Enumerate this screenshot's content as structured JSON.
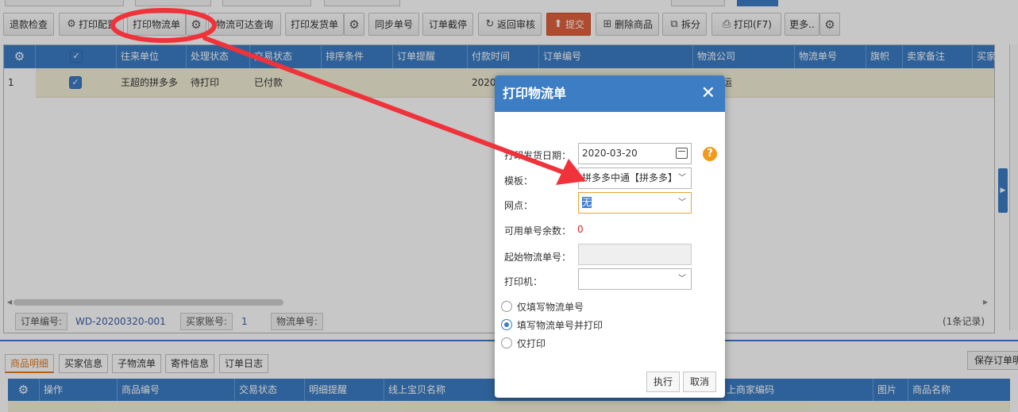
{
  "toolbar": {
    "refund_check": "退款检查",
    "print_config": "打印配置",
    "print_waybill": "打印物流单",
    "logistics_query": "物流可达查询",
    "print_delivery": "打印发货单",
    "sync_number": "同步单号",
    "order_intercept": "订单截停",
    "return_review": "返回审核",
    "submit": "提交",
    "delete_item": "删除商品",
    "split": "拆分",
    "print": "打印(F7)",
    "more": "更多.."
  },
  "grid": {
    "columns": [
      "往来单位",
      "处理状态",
      "交易状态",
      "排序条件",
      "订单提醒",
      "付款时间",
      "订单编号",
      "物流公司",
      "物流单号",
      "旗帜",
      "卖家备注",
      "买家"
    ],
    "row": {
      "index": "1",
      "partner": "王超的拼多多",
      "process_status": "待打印",
      "trade_status": "已付款",
      "pay_time": "2020-",
      "logistics": "运"
    }
  },
  "footer": {
    "order_no_label": "订单编号:",
    "order_no_value": "WD-20200320-001",
    "buyer_label": "买家账号:",
    "buyer_value": "1",
    "logistics_no_label": "物流单号:",
    "records": "(1条记录)"
  },
  "bottom_tabs": [
    "商品明细",
    "买家信息",
    "子物流单",
    "寄件信息",
    "订单日志"
  ],
  "save_order": "保存订单明",
  "detail_grid": {
    "columns": [
      "操作",
      "商品编号",
      "交易状态",
      "明细提醒",
      "线上宝贝名称",
      "上商家编码",
      "图片",
      "商品名称"
    ]
  },
  "dialog": {
    "title": "打印物流单",
    "ship_date_label": "打印发货日期：",
    "ship_date_value": "2020-03-20",
    "template_label": "模板：",
    "template_value": "拼多多中通【拼多多】",
    "outlet_label": "网点：",
    "outlet_value": "无",
    "available_label": "可用单号余数：",
    "available_value": "0",
    "start_no_label": "起始物流单号：",
    "printer_label": "打印机：",
    "options": [
      "仅填写物流单号",
      "填写物流单号并打印",
      "仅打印"
    ],
    "selected_option": 1,
    "execute": "执行",
    "cancel": "取消"
  },
  "colors": {
    "header_blue": "#3c7dc4",
    "row_highlight": "#f2f0d8",
    "annotation_red": "#f0323a",
    "submit_orange": "#e0613b"
  }
}
